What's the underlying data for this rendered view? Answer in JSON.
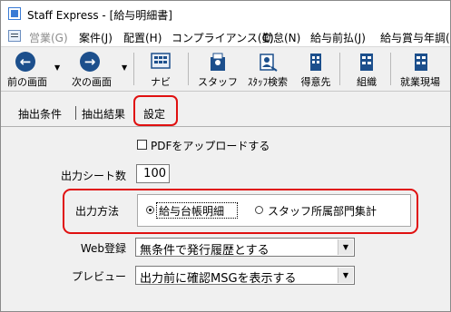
{
  "window": {
    "title": "Staff Express - [給与明細書]"
  },
  "menubar": {
    "items": [
      "営業(G)",
      "案件(J)",
      "配置(H)",
      "コンプライアンス(C)",
      "勤怠(N)",
      "給与前払(J)",
      "給与賞与年調(K)"
    ]
  },
  "toolbar": {
    "back_label": "前の画面",
    "forward_label": "次の画面",
    "navi_label": "ナビ",
    "staff_label": "スタッフ",
    "staff_search_label": "ｽﾀｯﾌ検索",
    "client_label": "得意先",
    "org_label": "組織",
    "workplace_label": "就業現場"
  },
  "tabs": [
    "抽出条件",
    "抽出結果",
    "設定"
  ],
  "settings": {
    "pdf_upload_label": "PDFをアップロードする",
    "pdf_upload_checked": false,
    "sheet_count_label": "出力シート数",
    "sheet_count_value": "100",
    "output_method_label": "出力方法",
    "output_method_options": [
      "給与台帳明細",
      "スタッフ所属部門集計"
    ],
    "output_method_selected": 0,
    "web_label": "Web登録",
    "web_value": "無条件で発行履歴とする",
    "preview_label": "プレビュー",
    "preview_value": "出力前に確認MSGを表示する"
  },
  "colors": {
    "highlight": "#e01010",
    "icon_blue": "#1c4f8c"
  }
}
